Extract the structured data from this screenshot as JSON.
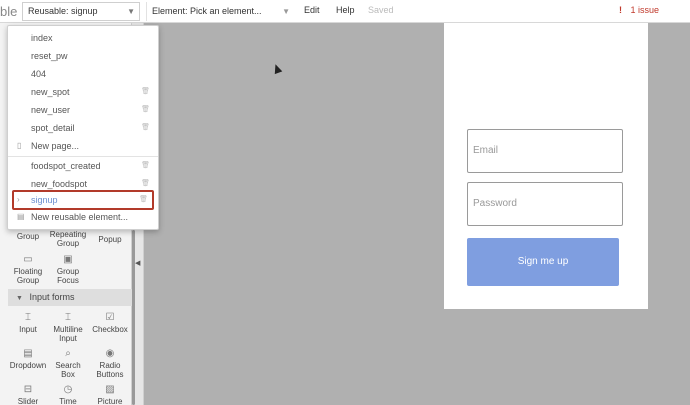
{
  "topbar": {
    "page_selector_value": "Reusable: signup",
    "element_selector_value": "Element: Pick an element...",
    "menu_edit": "Edit",
    "menu_help": "Help",
    "save_status": "Saved",
    "issues_label": "1 issue",
    "logo_text": "ble"
  },
  "page_menu": {
    "items": [
      {
        "label": "index"
      },
      {
        "label": "reset_pw"
      },
      {
        "label": "404"
      },
      {
        "label": "new_spot"
      },
      {
        "label": "new_user"
      },
      {
        "label": "spot_detail"
      },
      {
        "label": "New page..."
      },
      {
        "label": "foodspot_created"
      },
      {
        "label": "new_foodspot"
      },
      {
        "label": "signup"
      },
      {
        "label": "New reusable element..."
      }
    ]
  },
  "palette": {
    "row1": [
      "Group",
      "Repeating Group",
      "Popup"
    ],
    "row2": [
      "Floating Group",
      "Group Focus"
    ],
    "section_label": "Input forms",
    "inputs_row1": [
      "Input",
      "Multiline Input",
      "Checkbox"
    ],
    "inputs_row2": [
      "Dropdown",
      "Search Box",
      "Radio Buttons"
    ],
    "inputs_row3": [
      "Slider",
      "Time",
      "Picture"
    ]
  },
  "canvas": {
    "email_placeholder": "Email",
    "password_placeholder": "Password",
    "signup_button": "Sign me up"
  },
  "colors": {
    "accent_button": "#7f9ee0",
    "issue_red": "#c0392b",
    "selection_border": "#b23a2a"
  }
}
